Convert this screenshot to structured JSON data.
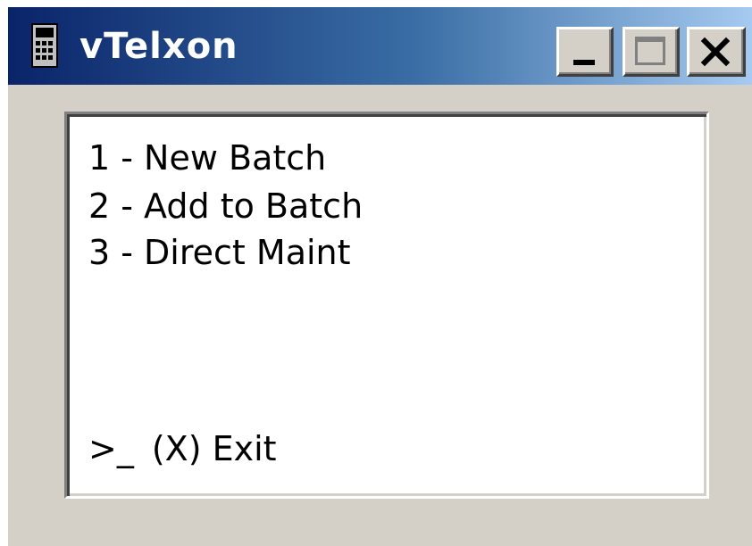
{
  "window": {
    "title": "vTelxon",
    "icon": "calculator-icon"
  },
  "title_buttons": {
    "minimize_icon": "minimize-icon",
    "maximize_icon": "maximize-icon",
    "close_icon": "close-icon"
  },
  "menu": {
    "items": [
      {
        "label": "1 - New Batch"
      },
      {
        "label": "2 - Add to Batch"
      },
      {
        "label": "3 - Direct Maint"
      }
    ],
    "prompt": ">_",
    "exit_label": "(X) Exit"
  },
  "colors": {
    "titlebar_start": "#0a246a",
    "titlebar_end": "#a6caf0",
    "window_face": "#d4d0c8",
    "screen_background": "#ffffff"
  }
}
